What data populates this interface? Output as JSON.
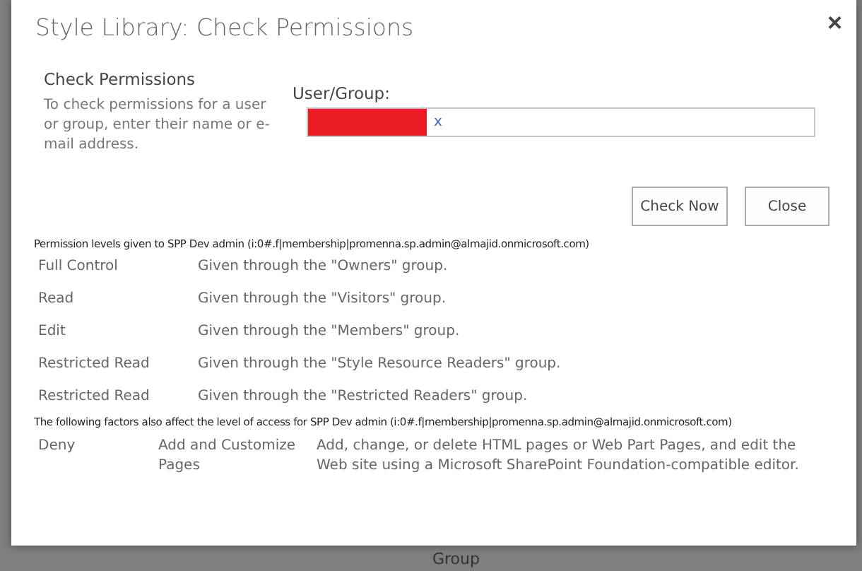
{
  "dialog": {
    "title": "Style Library: Check Permissions",
    "close_icon": "×"
  },
  "section": {
    "heading": "Check Permissions",
    "description": "To check permissions for a user or group, enter their name or e-mail address."
  },
  "user_group": {
    "label": "User/Group:",
    "remove_link": "x"
  },
  "buttons": [
    "Check Now",
    "Close"
  ],
  "permissions_heading": "Permission levels given to SPP Dev admin (i:0#.f|membership|promenna.sp.admin@almajid.onmicrosoft.com)",
  "permissions": [
    {
      "level": "Full Control",
      "source": "Given through the \"Owners\" group."
    },
    {
      "level": "Read",
      "source": "Given through the \"Visitors\" group."
    },
    {
      "level": "Edit",
      "source": "Given through the \"Members\" group."
    },
    {
      "level": "Restricted Read",
      "source": "Given through the \"Style Resource Readers\" group."
    },
    {
      "level": "Restricted Read",
      "source": "Given through the \"Restricted Readers\" group."
    }
  ],
  "factors_heading": "The following factors also affect the level of access for SPP Dev admin (i:0#.f|membership|promenna.sp.admin@almajid.onmicrosoft.com)",
  "factors": [
    {
      "type": "Deny",
      "permission": "Add and Customize Pages",
      "description": "Add, change, or delete HTML pages or Web Part Pages, and edit the Web site using a Microsoft SharePoint Foundation-compatible editor."
    }
  ],
  "background_text": "Group"
}
